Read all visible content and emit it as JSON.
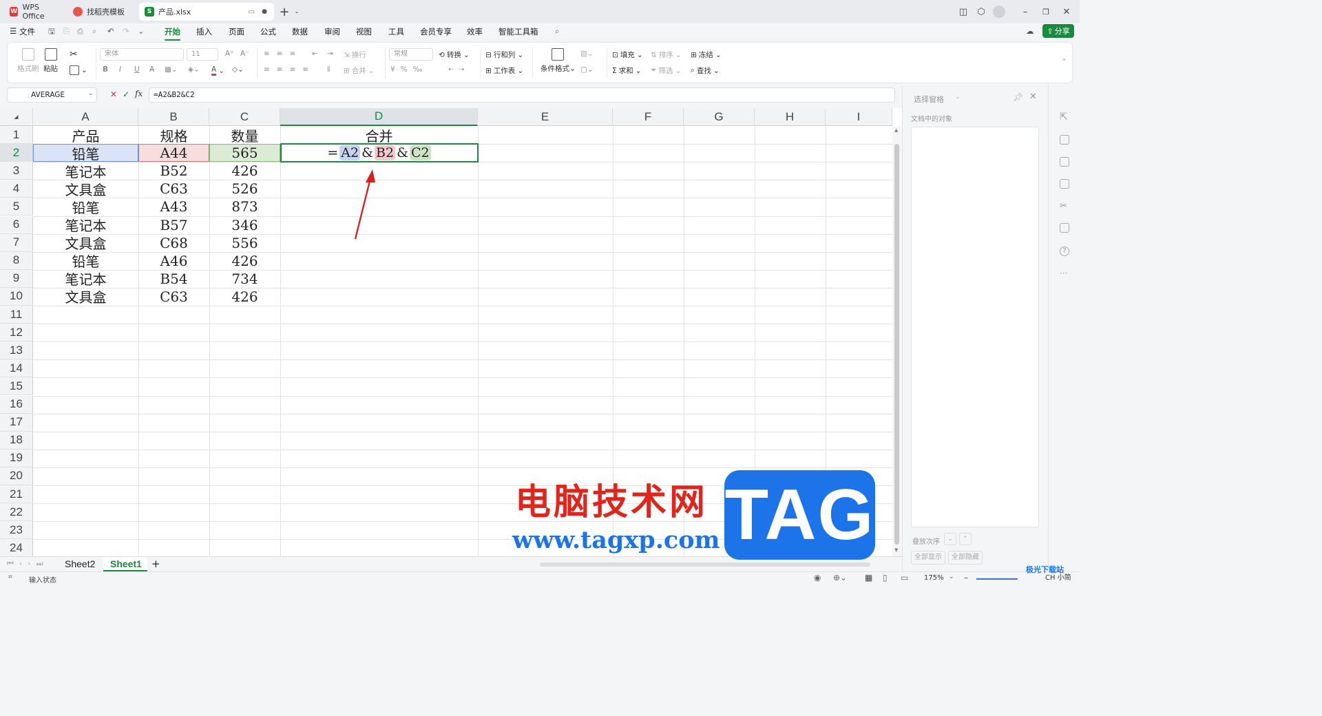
{
  "titlebar": {
    "tabs": [
      {
        "label": "WPS Office",
        "icon": "wps-logo-icon"
      },
      {
        "label": "找稻壳模板",
        "icon": "docer-logo-icon"
      },
      {
        "label": "产品.xlsx",
        "icon": "spreadsheet-logo-icon",
        "logo_text": "S"
      }
    ],
    "new_tab": "+"
  },
  "menubar": {
    "file": "文件",
    "tabs": [
      "开始",
      "插入",
      "页面",
      "公式",
      "数据",
      "审阅",
      "视图",
      "工具",
      "会员专享",
      "效率",
      "智能工具箱"
    ],
    "active_tab": "开始",
    "share": "分享"
  },
  "ribbon": {
    "format_painter": "格式刷",
    "paste": "粘贴",
    "font_name": "宋体",
    "font_size": "11",
    "wrap": "换行",
    "number_format": "常规",
    "convert": "转换",
    "row_col": "行和列",
    "worksheet": "工作表",
    "cond_format": "条件格式",
    "merge": "合并",
    "fill": "填充",
    "sort": "排序",
    "freeze": "冻结",
    "sum": "求和",
    "filter": "筛选",
    "find": "查找",
    "bold": "B",
    "italic": "I",
    "underline": "U"
  },
  "formula_bar": {
    "name_box": "AVERAGE",
    "cancel": "✕",
    "confirm": "✓",
    "fx": "fx",
    "formula": "=A2&B2&C2"
  },
  "columns": [
    "A",
    "B",
    "C",
    "D",
    "E",
    "F",
    "G",
    "H",
    "I"
  ],
  "rows": [
    "1",
    "2",
    "3",
    "4",
    "5",
    "6",
    "7",
    "8",
    "9",
    "10",
    "11",
    "12",
    "13",
    "14",
    "15",
    "16",
    "17",
    "18",
    "19",
    "20",
    "21",
    "22",
    "23",
    "24"
  ],
  "table": {
    "headers": [
      "产品",
      "规格",
      "数量",
      "合并"
    ],
    "data": [
      [
        "铅笔",
        "A44",
        "565"
      ],
      [
        "笔记本",
        "B52",
        "426"
      ],
      [
        "文具盒",
        "C63",
        "526"
      ],
      [
        "铅笔",
        "A43",
        "873"
      ],
      [
        "笔记本",
        "B57",
        "346"
      ],
      [
        "文具盒",
        "C68",
        "556"
      ],
      [
        "铅笔",
        "A46",
        "426"
      ],
      [
        "笔记本",
        "B54",
        "734"
      ],
      [
        "文具盒",
        "C63",
        "426"
      ]
    ],
    "editing_formula": {
      "eq": "=",
      "a": "A2",
      "amp1": "&",
      "b": "B2",
      "amp2": "&",
      "c": "C2"
    }
  },
  "sheet_tabs": [
    "Sheet2",
    "Sheet1"
  ],
  "active_sheet": "Sheet1",
  "add_sheet": "+",
  "status": {
    "mode": "输入状态",
    "zoom": "175%"
  },
  "side_panel": {
    "title": "选择窗格",
    "subtitle": "文档中的对象",
    "order_label": "叠放次序",
    "show_all": "全部显示",
    "hide_all": "全部隐藏"
  },
  "watermark": {
    "text_cn": "电脑技术网",
    "url": "www.tagxp.com",
    "badge": "TAG",
    "corner": "极光下载站",
    "ime": "CH 小简"
  },
  "colors": {
    "accent": "#1b8a3e",
    "ref_a": "#c7d3f0",
    "ref_b": "#f2c9cc",
    "ref_c": "#cfe3c6",
    "watermark_red": "#e0251d",
    "watermark_blue": "#1d74e8"
  }
}
